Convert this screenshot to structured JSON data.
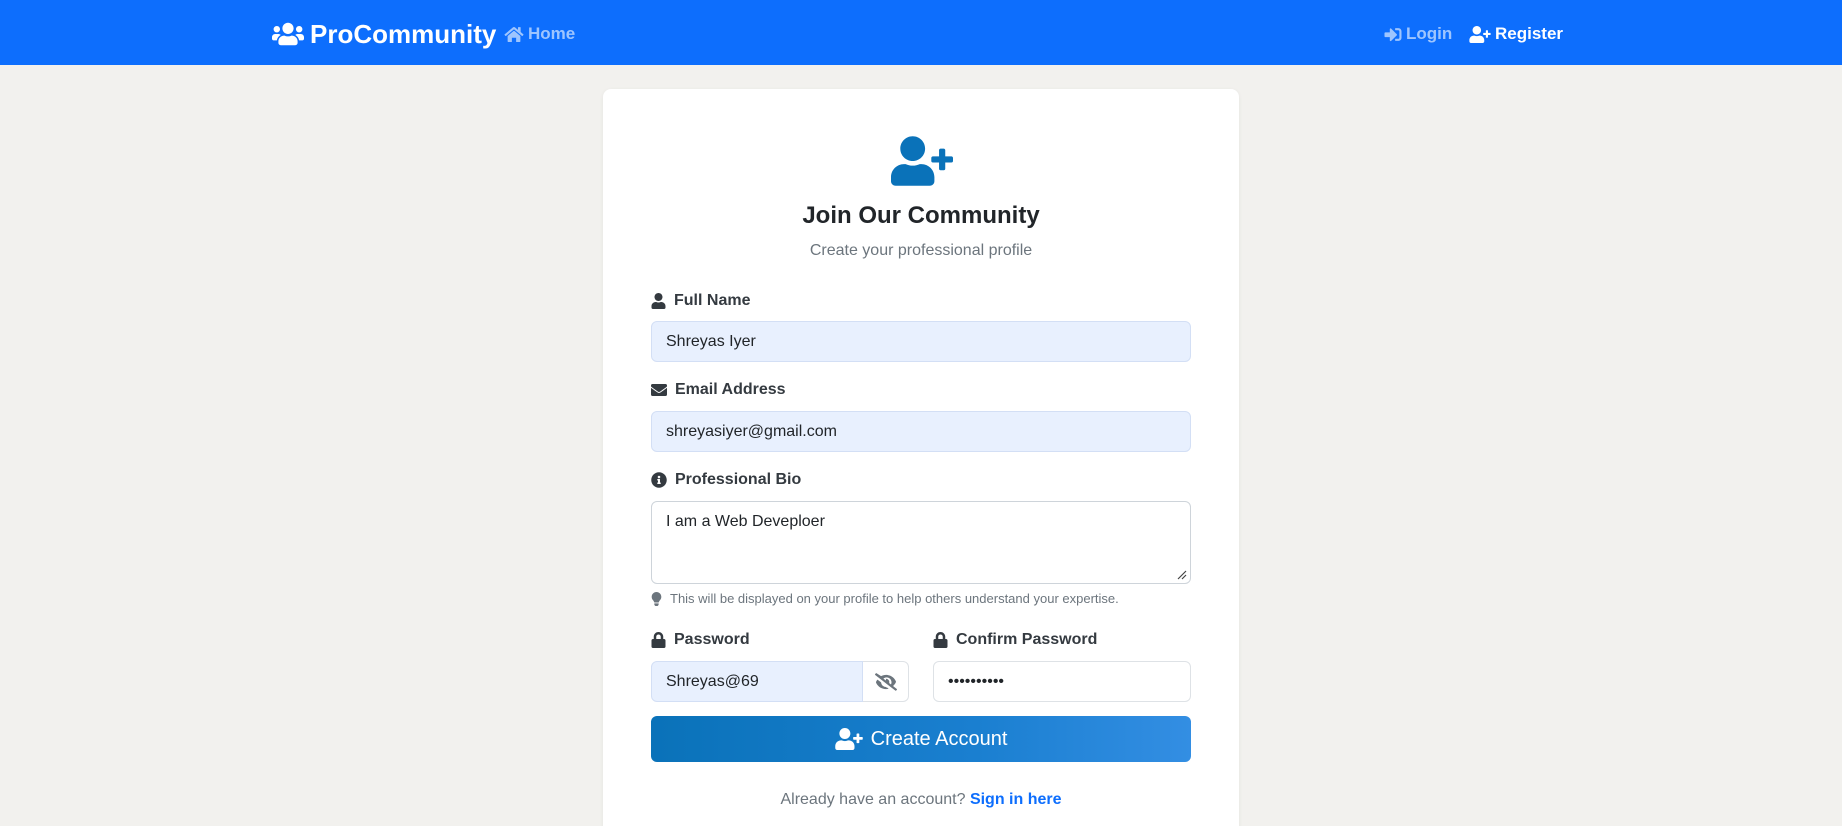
{
  "nav": {
    "brand": "ProCommunity",
    "home": "Home",
    "login": "Login",
    "register": "Register"
  },
  "form": {
    "title": "Join Our Community",
    "subtitle": "Create your professional profile",
    "full_name_label": "Full Name",
    "full_name_value": "Shreyas Iyer",
    "email_label": "Email Address",
    "email_value": "shreyasiyer@gmail.com",
    "bio_label": "Professional Bio",
    "bio_value": "I am a Web Deveploer",
    "bio_hint": "This will be displayed on your profile to help others understand your expertise.",
    "password_label": "Password",
    "password_value": "Shreyas@69",
    "confirm_label": "Confirm Password",
    "confirm_value": "••••••••••",
    "submit_label": "Create Account",
    "signin_prompt": "Already have an account?",
    "signin_link": "Sign in here"
  },
  "colors": {
    "primary": "#0d6efd",
    "icon_blue": "#0a72b9",
    "page_bg": "#f2f1ee",
    "autofill_bg": "#e8f0fe"
  },
  "icons": {
    "brand": "users-icon",
    "home": "home-icon",
    "login": "sign-in-icon",
    "register": "user-plus-icon",
    "hero": "user-plus-icon",
    "full_name": "user-icon",
    "email": "envelope-icon",
    "bio": "info-circle-icon",
    "hint": "lightbulb-icon",
    "password": "lock-icon",
    "confirm": "lock-icon",
    "toggle": "eye-slash-icon",
    "submit": "user-plus-icon"
  }
}
